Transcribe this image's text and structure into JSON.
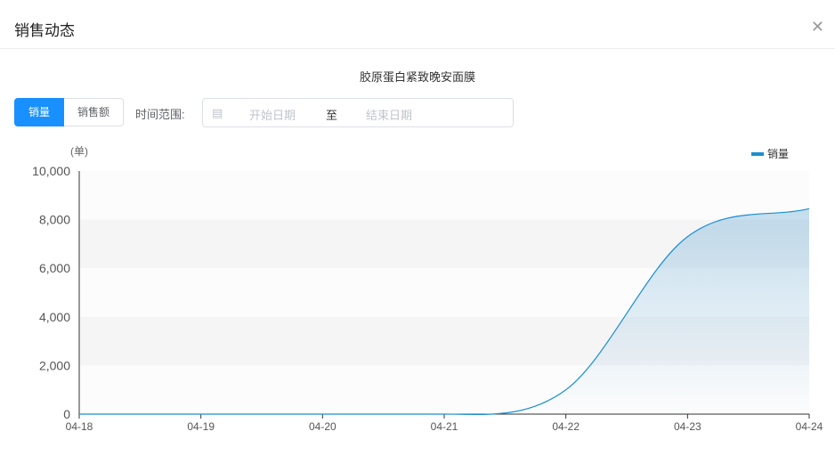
{
  "dialog": {
    "title": "销售动态",
    "close_icon": "close-icon"
  },
  "toggle": {
    "quantity": "销量",
    "amount": "销售额"
  },
  "filter": {
    "label": "时间范围:",
    "start_placeholder": "开始日期",
    "separator": "至",
    "end_placeholder": "结束日期",
    "icon": "calendar-icon"
  },
  "chart_data": {
    "type": "line",
    "title": "胶原蛋白紧致晚安面膜",
    "ylabel": "(单)",
    "x": [
      "04-18",
      "04-19",
      "04-20",
      "04-21",
      "04-22",
      "04-23",
      "04-24"
    ],
    "series": [
      {
        "name": "销量",
        "values": [
          0,
          0,
          0,
          0,
          1000,
          7300,
          8450
        ],
        "color": "#1a8fd1"
      }
    ],
    "ylim": [
      0,
      10000
    ],
    "yticks": [
      "0",
      "2,000",
      "4,000",
      "6,000",
      "8,000",
      "10,000"
    ],
    "legend": "top-right",
    "smooth": true,
    "area": true
  }
}
